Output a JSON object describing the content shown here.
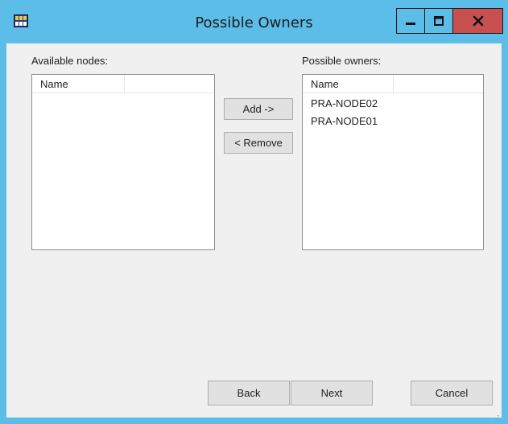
{
  "window": {
    "title": "Possible Owners",
    "icons": {
      "app": "cluster-app-icon",
      "minimize": "minimize-icon",
      "maximize": "maximize-icon",
      "close": "close-icon"
    },
    "colors": {
      "frame": "#5bbde8",
      "close": "#c75050",
      "client": "#f0f0f0"
    }
  },
  "available": {
    "label": "Available nodes:",
    "column": "Name",
    "items": []
  },
  "owners": {
    "label": "Possible owners:",
    "column": "Name",
    "items": [
      "PRA-NODE02",
      "PRA-NODE01"
    ]
  },
  "buttons": {
    "add": "Add ->",
    "remove": "< Remove",
    "back": "Back",
    "next": "Next",
    "cancel": "Cancel"
  }
}
